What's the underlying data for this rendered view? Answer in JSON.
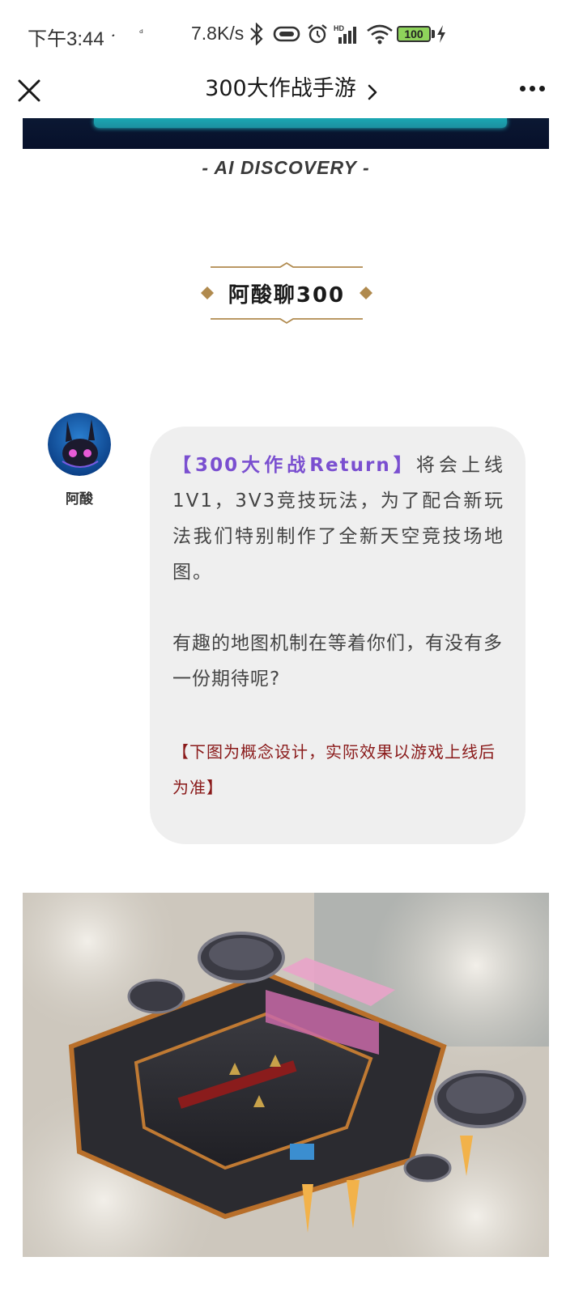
{
  "status_bar": {
    "time": "下午3:44",
    "tiny_icons": [
      "𝅘",
      "ᵈ"
    ],
    "net_speed": "7.8K/s",
    "battery": "100",
    "icons": [
      "bluetooth-icon",
      "vibrate-icon",
      "alarm-icon",
      "hd-signal-icon",
      "wifi-icon",
      "battery-icon",
      "charging-icon"
    ]
  },
  "nav": {
    "title": "300大作战手游",
    "icons": [
      "close-icon",
      "chevron-right-icon",
      "more-icon"
    ]
  },
  "caption": "- AI DISCOVERY -",
  "section": {
    "title": "阿酸聊300",
    "accent_color": "#b08a4e"
  },
  "author": {
    "name": "阿酸"
  },
  "message": {
    "highlight": "【300大作战Return】",
    "p1_rest": "将会上线1V1，3V3竞技玩法，为了配合新玩法我们特别制作了全新天空竞技场地图。",
    "p2": "有趣的地图机制在等着你们，有没有多一份期待呢?",
    "note": "【下图为概念设计，实际效果以游戏上线后为准】",
    "highlight_color": "#7a4fd0",
    "note_color": "#8a1a1a"
  }
}
